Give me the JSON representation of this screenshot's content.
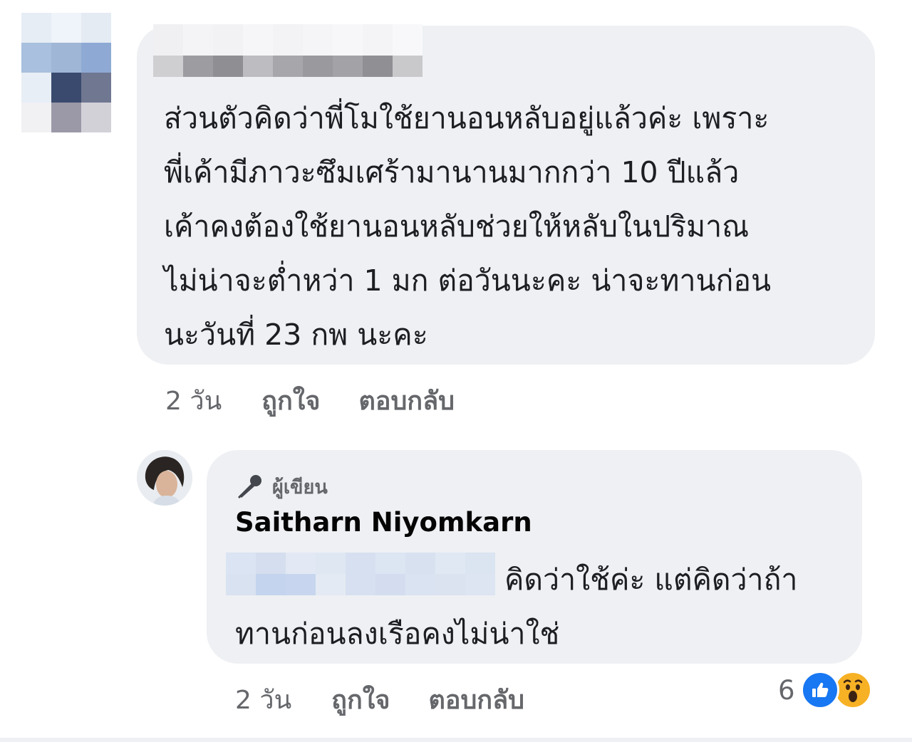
{
  "comments": [
    {
      "text": "ส่วนตัวคิดว่าพี่โมใช้ยานอนหลับอยู่แล้วค่ะ เพราะ\nพี่เค้ามีภาวะซึมเศร้ามานานมากกว่า 10 ปีแล้ว\nเค้าคงต้องใช้ยานอนหลับช่วยให้หลับในปริมาณ\nไม่น่าจะต่ำหว่า 1 มก ต่อวันนะคะ น่าจะทานก่อน\nนะวันที่ 23 กพ นะคะ",
      "time": "2 วัน",
      "like_label": "ถูกใจ",
      "reply_label": "ตอบกลับ"
    }
  ],
  "reply": {
    "badge": "ผู้เขียน",
    "author": "Saitharn Niyomkarn",
    "text": "คิดว่าใช้ค่ะ แต่คิดว่าถ้าทานก่อนลงเรือคงไม่น่าใช่",
    "time": "2 วัน",
    "like_label": "ถูกใจ",
    "reply_label": "ตอบกลับ",
    "reaction_count": "6",
    "reaction_icons": [
      "like-icon",
      "wow-icon"
    ]
  },
  "colors": {
    "bubble": "#eef0f3",
    "meta_text": "#65676b",
    "like_blue": "#1877f2",
    "wow_yellow": "#f7b125"
  }
}
